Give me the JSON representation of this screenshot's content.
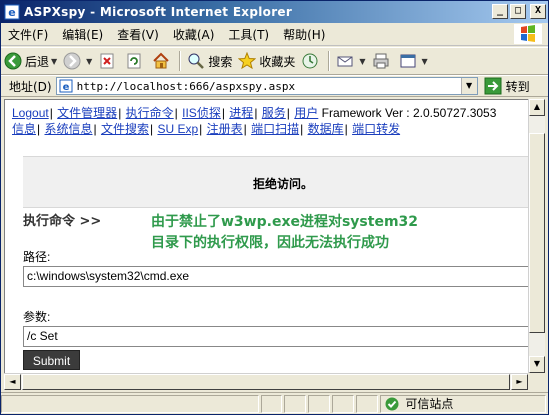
{
  "window": {
    "title": "ASPXspy - Microsoft Internet Explorer",
    "minimize": "_",
    "maximize": "□",
    "close": "X"
  },
  "menu": [
    "文件(F)",
    "编辑(E)",
    "查看(V)",
    "收藏(A)",
    "工具(T)",
    "帮助(H)"
  ],
  "toolbar": {
    "back": "后退",
    "search": "搜索",
    "favorites": "收藏夹"
  },
  "address": {
    "label": "地址(D)",
    "url": "http://localhost:666/aspxspy.aspx",
    "go": "转到"
  },
  "nav": {
    "row1": [
      "Logout",
      "文件管理器",
      "执行命令",
      "IIS侦探",
      "进程",
      "服务",
      "用户"
    ],
    "framework": "Framework Ver : 2.0.50727.3053",
    "row2": [
      "信息",
      "系统信息",
      "文件搜索",
      "SU Exp",
      "注册表",
      "端口扫描",
      "数据库",
      "端口转发"
    ]
  },
  "main": {
    "access_denied": "拒绝访问。",
    "section_title": "执行命令 >>",
    "annotation_line1": "由于禁止了w3wp.exe进程对system32",
    "annotation_line2": "目录下的执行权限，因此无法执行成功",
    "path_label": "路径:",
    "path_value": "c:\\windows\\system32\\cmd.exe",
    "args_label": "参数:",
    "args_value": "/c Set",
    "submit_label": "Submit"
  },
  "status": {
    "zone": "可信站点"
  },
  "colors": {
    "titlebar": "#0a246a",
    "link": "#1a3ebd",
    "annotation": "#2f9a4c",
    "submit_bg": "#3b3b3b"
  }
}
